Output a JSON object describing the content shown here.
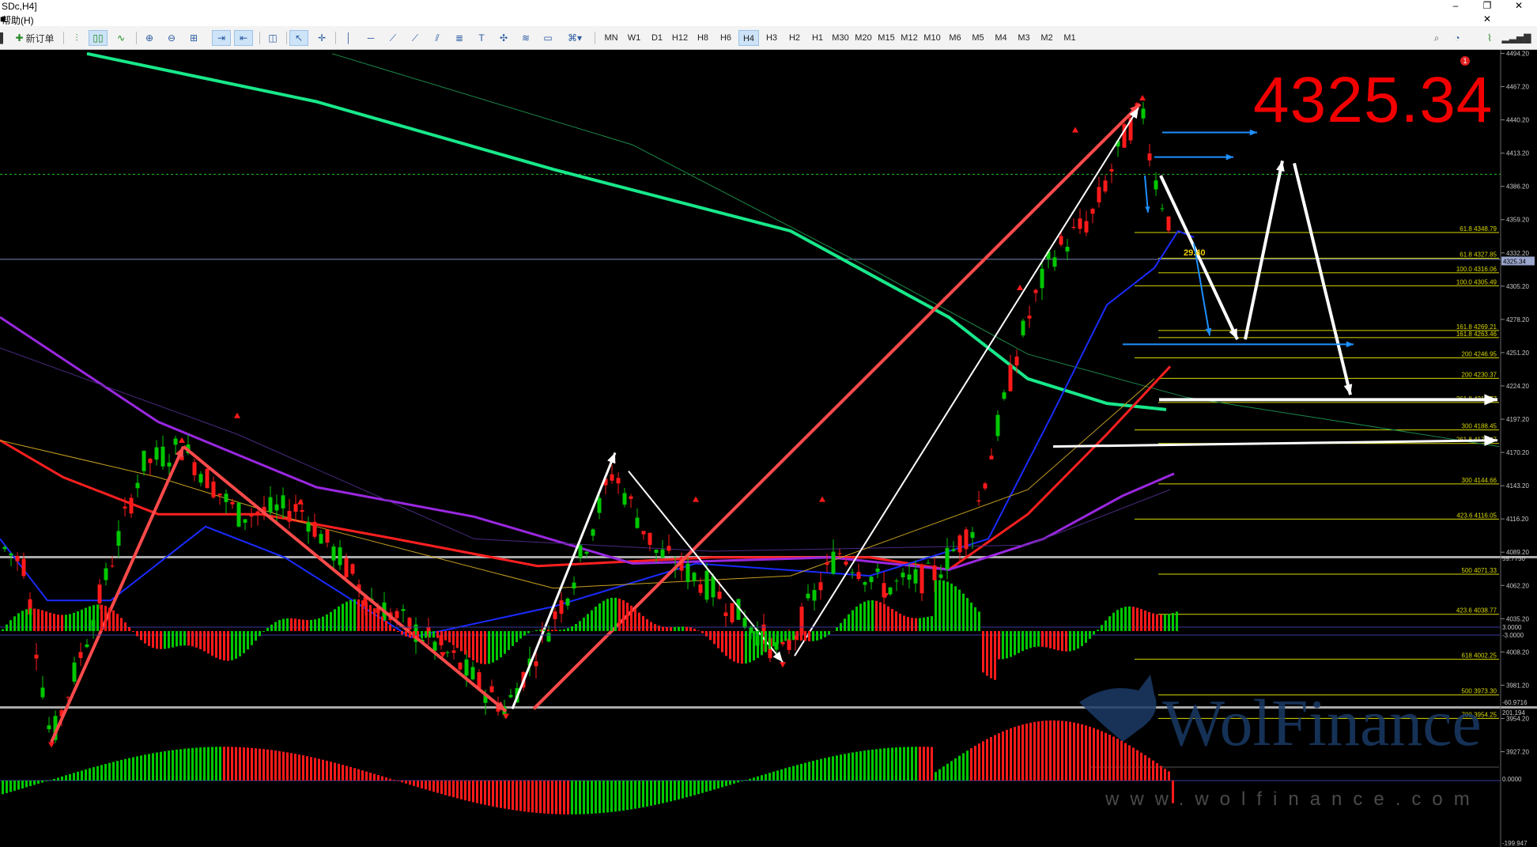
{
  "window": {
    "title": "SDc,H4]",
    "minimize": "–",
    "maximize": "❐",
    "close": "✕",
    "sub_close": "✕"
  },
  "menu": {
    "help": "帮助(H)",
    "left_glyph": "■"
  },
  "toolbar": {
    "new_order": "新订单",
    "timeframes": [
      "MN",
      "W1",
      "D1",
      "H12",
      "H8",
      "H6",
      "H4",
      "H3",
      "H2",
      "H1",
      "M30",
      "M20",
      "M15",
      "M12",
      "M10",
      "M6",
      "M5",
      "M4",
      "M3",
      "M2",
      "M1"
    ],
    "active_timeframe": "H4",
    "notification_count": "1"
  },
  "price_axis": [
    "4494.20",
    "4467.20",
    "4440.20",
    "4413.20",
    "4386.20",
    "4359.20",
    "4332.20",
    "4305.20",
    "4278.20",
    "4251.20",
    "4224.20",
    "4197.20",
    "4170.20",
    "4143.20",
    "4116.20",
    "4089.20",
    "4062.20",
    "4035.20",
    "4008.20",
    "3981.20",
    "3954.20",
    "3927.20"
  ],
  "current_price": "4325.34",
  "annotation": {
    "big_price": "4325.34",
    "small_label": "29.40"
  },
  "fib_levels": [
    {
      "label": "61.8  4348.79",
      "price": 4348.79
    },
    {
      "label": "61.8  4327.85",
      "price": 4327.85
    },
    {
      "label": "100.0 4316.06",
      "price": 4316.06
    },
    {
      "label": "100.0 4305.49",
      "price": 4305.49
    },
    {
      "label": "161.8  4269.21",
      "price": 4269.21
    },
    {
      "label": "161.8  4263.46",
      "price": 4263.46
    },
    {
      "label": "200  4246.95",
      "price": 4246.95
    },
    {
      "label": "200  4230.37",
      "price": 4230.37
    },
    {
      "label": "261.8  4210.77",
      "price": 4210.77
    },
    {
      "label": "300  4188.45",
      "price": 4188.45
    },
    {
      "label": "261.8  4177.47",
      "price": 4177.47
    },
    {
      "label": "300  4144.66",
      "price": 4144.66
    },
    {
      "label": "423.6  4116.05",
      "price": 4116.05
    },
    {
      "label": "500  4071.33",
      "price": 4071.33
    },
    {
      "label": "423.6  4038.77",
      "price": 4038.77
    },
    {
      "label": "618  4002.25",
      "price": 4002.25
    },
    {
      "label": "500  3973.30",
      "price": 3973.3
    },
    {
      "label": "700  3954.25",
      "price": 3954.25
    }
  ],
  "indicator1_axis": [
    "59.7750",
    "3.0000",
    "-3.0000",
    "-60.9716"
  ],
  "indicator2_axis": [
    "201.194",
    "0.0000",
    "-199.947"
  ],
  "watermark": {
    "brand": "WolFinance",
    "url": "www.wolfinance.com"
  },
  "colors": {
    "bull": "#00c800",
    "bear": "#ff1a1a",
    "fib": "#d8d800",
    "ma_red": "#ff2020",
    "ma_green": "#18e88a",
    "ma_purple": "#9a28e0",
    "ma_blue": "#1a2bff",
    "arrow_red": "#ff4a4a",
    "arrow_white": "#ffffff",
    "arrow_blue": "#1e90ff"
  }
}
